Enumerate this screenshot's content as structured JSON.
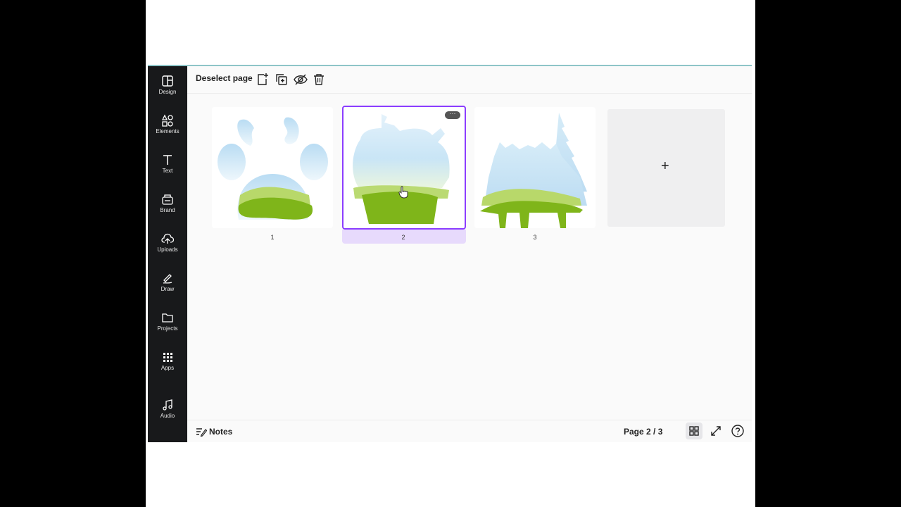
{
  "sidebar": {
    "items": [
      {
        "label": "Design",
        "icon": "design-icon"
      },
      {
        "label": "Elements",
        "icon": "elements-icon"
      },
      {
        "label": "Text",
        "icon": "text-icon"
      },
      {
        "label": "Brand",
        "icon": "brand-icon"
      },
      {
        "label": "Uploads",
        "icon": "uploads-icon"
      },
      {
        "label": "Draw",
        "icon": "draw-icon"
      },
      {
        "label": "Projects",
        "icon": "folder-icon"
      },
      {
        "label": "Apps",
        "icon": "apps-icon"
      },
      {
        "label": "Audio",
        "icon": "music-icon"
      }
    ]
  },
  "toolbar": {
    "deselect_label": "Deselect page",
    "icons": [
      "add-page-icon",
      "duplicate-page-icon",
      "hide-page-icon",
      "delete-icon"
    ]
  },
  "pages": [
    {
      "number": "1"
    },
    {
      "number": "2"
    },
    {
      "number": "3"
    }
  ],
  "add_page_symbol": "+",
  "more_symbol": "···",
  "footer": {
    "notes_label": "Notes",
    "page_indicator": "Page 2 / 3"
  },
  "colors": {
    "accent": "#8b3dff",
    "sidebar": "#18191b",
    "grass": "#7fb51a",
    "sky": "#cfe8f6"
  }
}
